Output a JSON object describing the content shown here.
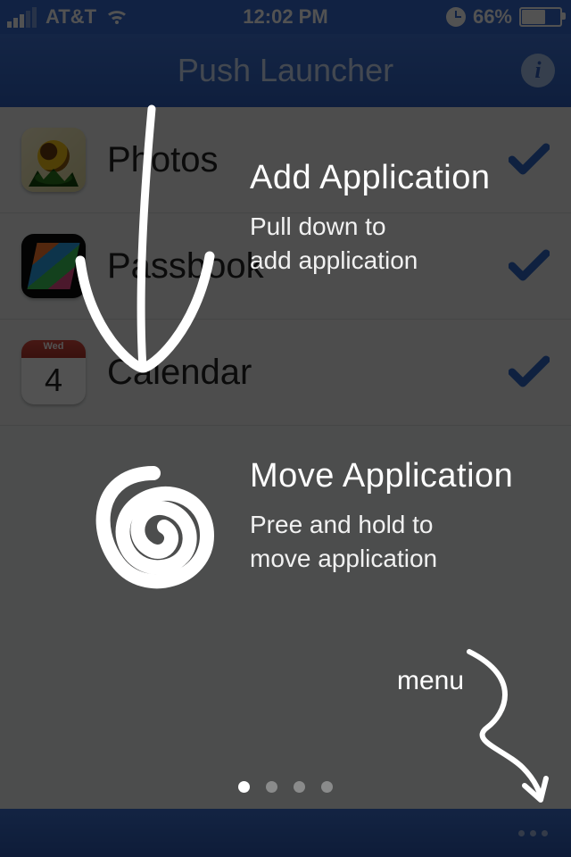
{
  "status": {
    "carrier": "AT&T",
    "time": "12:02 PM",
    "battery_pct": "66%",
    "battery_fill_pct": 66,
    "signal_bars_active": 3
  },
  "nav": {
    "title": "Push Launcher"
  },
  "apps": [
    {
      "name": "Photos"
    },
    {
      "name": "Passbook"
    },
    {
      "name": "Calendar",
      "calendar_day": "4",
      "calendar_weekday": "Wed"
    }
  ],
  "tutorial": {
    "tip1_title": "Add Application",
    "tip1_desc_l1": "Pull down to",
    "tip1_desc_l2": "add application",
    "tip2_title": "Move Application",
    "tip2_desc_l1": "Pree and hold to",
    "tip2_desc_l2": "move application",
    "menu_label": "menu"
  },
  "pager": {
    "count": 4,
    "active": 0
  }
}
